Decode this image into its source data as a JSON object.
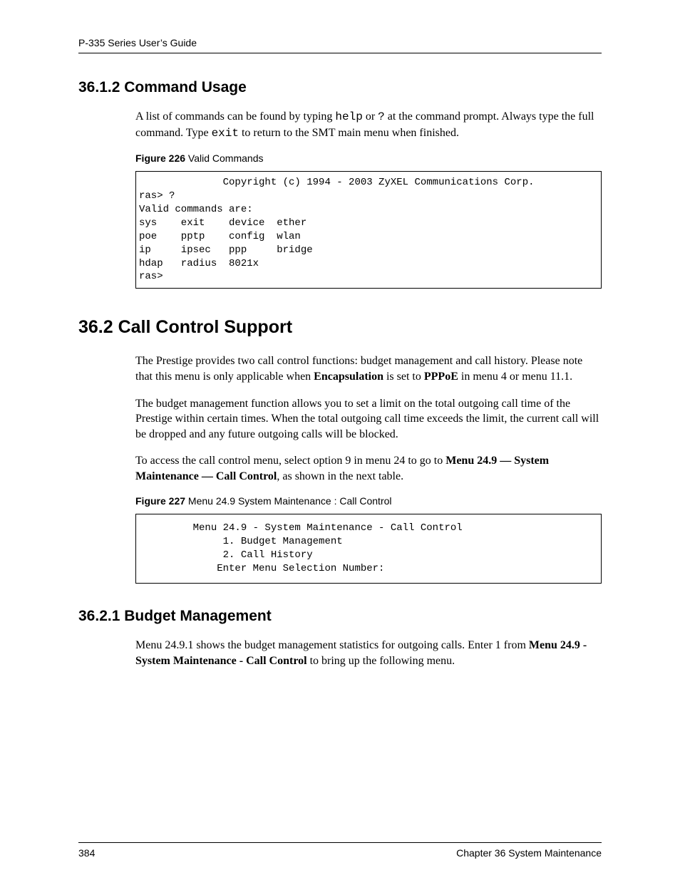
{
  "header": {
    "text": "P-335 Series User’s Guide"
  },
  "sections": {
    "s1": {
      "heading": "36.1.2  Command Usage",
      "para1_a": "A list of commands can be found by typing ",
      "para1_code1": "help",
      "para1_b": " or ",
      "para1_code2": "?",
      "para1_c": " at the command prompt. Always type the full command. Type ",
      "para1_code3": "exit",
      "para1_d": " to return to the SMT main menu when finished."
    },
    "fig226": {
      "label_bold": "Figure 226",
      "label_plain": "   Valid Commands",
      "code": "              Copyright (c) 1994 - 2003 ZyXEL Communications Corp.\nras> ?\nValid commands are:\nsys    exit    device  ether\npoe    pptp    config  wlan\nip     ipsec   ppp     bridge\nhdap   radius  8021x\nras>"
    },
    "s2": {
      "heading": "36.2  Call Control Support",
      "p1_a": "The Prestige provides two call control functions: budget management and call history. Please note that this menu is only applicable when ",
      "p1_b1": "Encapsulation",
      "p1_c": " is set to ",
      "p1_b2": "PPPoE",
      "p1_d": " in menu 4 or menu 11.1.",
      "p2": "The budget management function allows you to set a limit on the total outgoing call time of the Prestige within certain times. When the total outgoing call time exceeds the limit, the current call will be dropped and any future outgoing calls will be blocked.",
      "p3_a": "To access the call control menu, select option 9 in menu 24 to go to ",
      "p3_b": "Menu 24.9 — System Maintenance — Call Control",
      "p3_c": ", as shown in the next table."
    },
    "fig227": {
      "label_bold": "Figure 227",
      "label_plain": "   Menu 24.9 System Maintenance : Call Control",
      "code": "         Menu 24.9 - System Maintenance - Call Control\n              1. Budget Management\n              2. Call History\n             Enter Menu Selection Number:"
    },
    "s3": {
      "heading": "36.2.1  Budget Management",
      "p1_a": "Menu 24.9.1 shows the budget management statistics for outgoing calls. Enter 1 from ",
      "p1_b": "Menu 24.9 - System Maintenance - Call Control",
      "p1_c": " to bring up the following menu."
    }
  },
  "footer": {
    "page": "384",
    "chapter": "Chapter 36 System Maintenance"
  }
}
